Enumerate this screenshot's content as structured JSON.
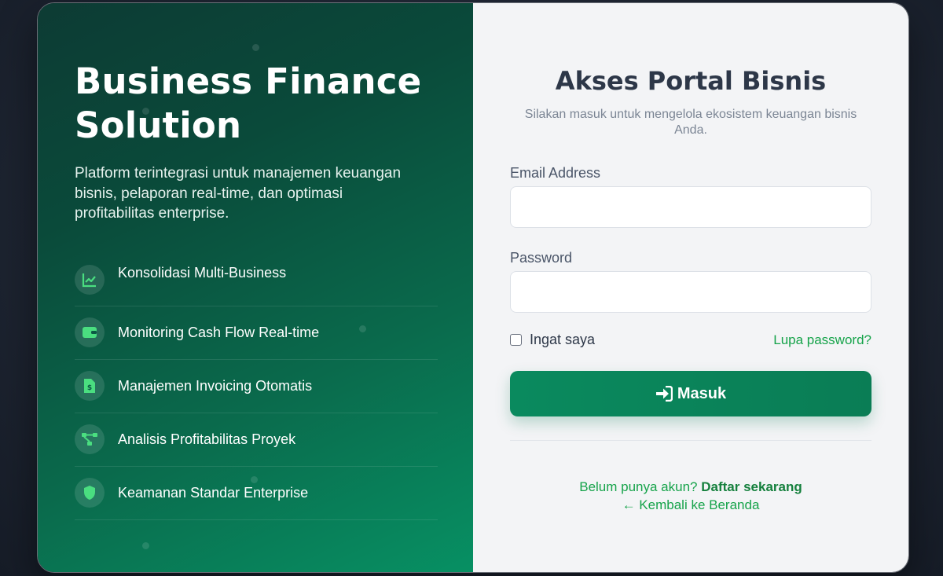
{
  "hero": {
    "title": "Business Finance Solution",
    "description": "Platform terintegrasi untuk manajemen keuangan bisnis, pelaporan real-time, dan optimasi profitabilitas enterprise."
  },
  "features": [
    {
      "label": "Konsolidasi Multi-Business",
      "icon": "chart-line-icon"
    },
    {
      "label": "Monitoring Cash Flow Real-time",
      "icon": "wallet-icon"
    },
    {
      "label": "Manajemen Invoicing Otomatis",
      "icon": "invoice-icon"
    },
    {
      "label": "Analisis Profitabilitas Proyek",
      "icon": "project-diagram-icon"
    },
    {
      "label": "Keamanan Standar Enterprise",
      "icon": "shield-icon"
    }
  ],
  "login": {
    "title": "Akses Portal Bisnis",
    "subtitle": "Silakan masuk untuk mengelola ekosistem keuangan bisnis Anda.",
    "email_label": "Email Address",
    "email_value": "",
    "password_label": "Password",
    "password_value": "",
    "remember_label": "Ingat saya",
    "remember_checked": false,
    "forgot_label": "Lupa password?",
    "submit_label": "Masuk",
    "register_prompt": "Belum punya akun?",
    "register_link": "Daftar sekarang",
    "back_link": "← Kembali ke Beranda"
  },
  "colors": {
    "accent": "#0a7d55",
    "link": "#16a34a",
    "panel_dark": "#0d3b34",
    "panel_light": "#079063"
  }
}
